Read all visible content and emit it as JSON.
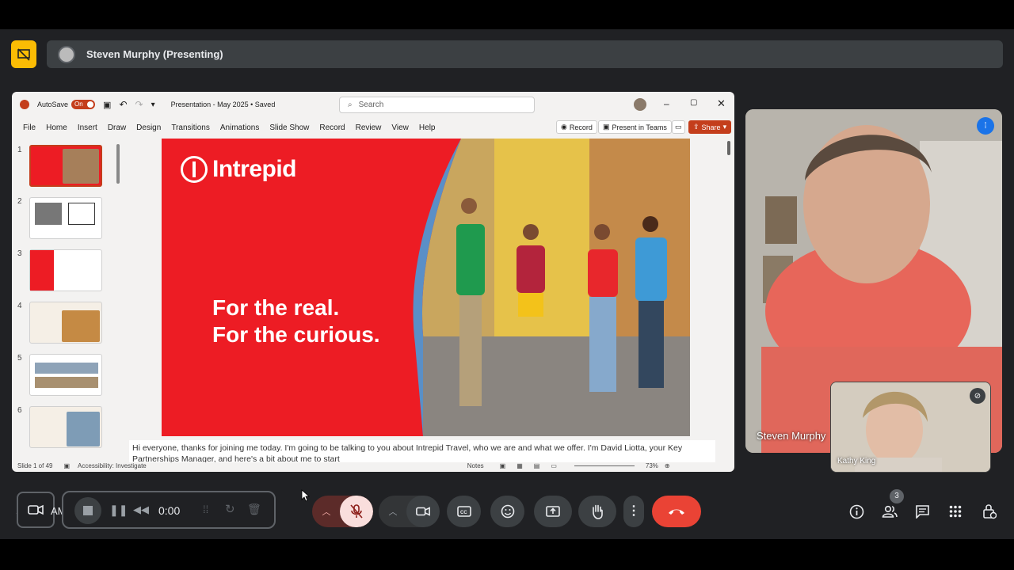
{
  "meeting": {
    "presenter_label": "Steven Murphy (Presenting)",
    "participant_count": "3",
    "timer": "0:00",
    "clock_fragment": "AM",
    "clock_prefix": "1"
  },
  "ppt": {
    "autosave_label": "AutoSave",
    "autosave_state": "On",
    "doc_title": "Presentation - May 2025 • Saved",
    "search_placeholder": "Search",
    "menu": [
      "File",
      "Home",
      "Insert",
      "Draw",
      "Design",
      "Transitions",
      "Animations",
      "Slide Show",
      "Record",
      "Review",
      "View",
      "Help"
    ],
    "record_btn": "Record",
    "present_btn": "Present in Teams",
    "share_btn": "Share",
    "thumbnails": [
      "1",
      "2",
      "3",
      "4",
      "5",
      "6"
    ],
    "slide_logo": "Intrepid",
    "slide_line1": "For the real.",
    "slide_line2": "For the curious.",
    "notes": "Hi everyone, thanks for joining me today. I'm going to be talking to you about Intrepid Travel, who we are and what we offer. I'm David Liotta, your Key Partnerships Manager, and here's a bit about me to start",
    "status_slide": "Slide 1 of 49",
    "status_accessibility": "Accessibility: Investigate",
    "status_notes": "Notes",
    "zoom": "73%"
  },
  "participants": {
    "main_name": "Steven Murphy",
    "secondary_name": "Kathy King"
  },
  "colors": {
    "accent_red": "#ea4335",
    "brand_red": "#ed1c24",
    "presenting_yellow": "#fbbc04"
  }
}
